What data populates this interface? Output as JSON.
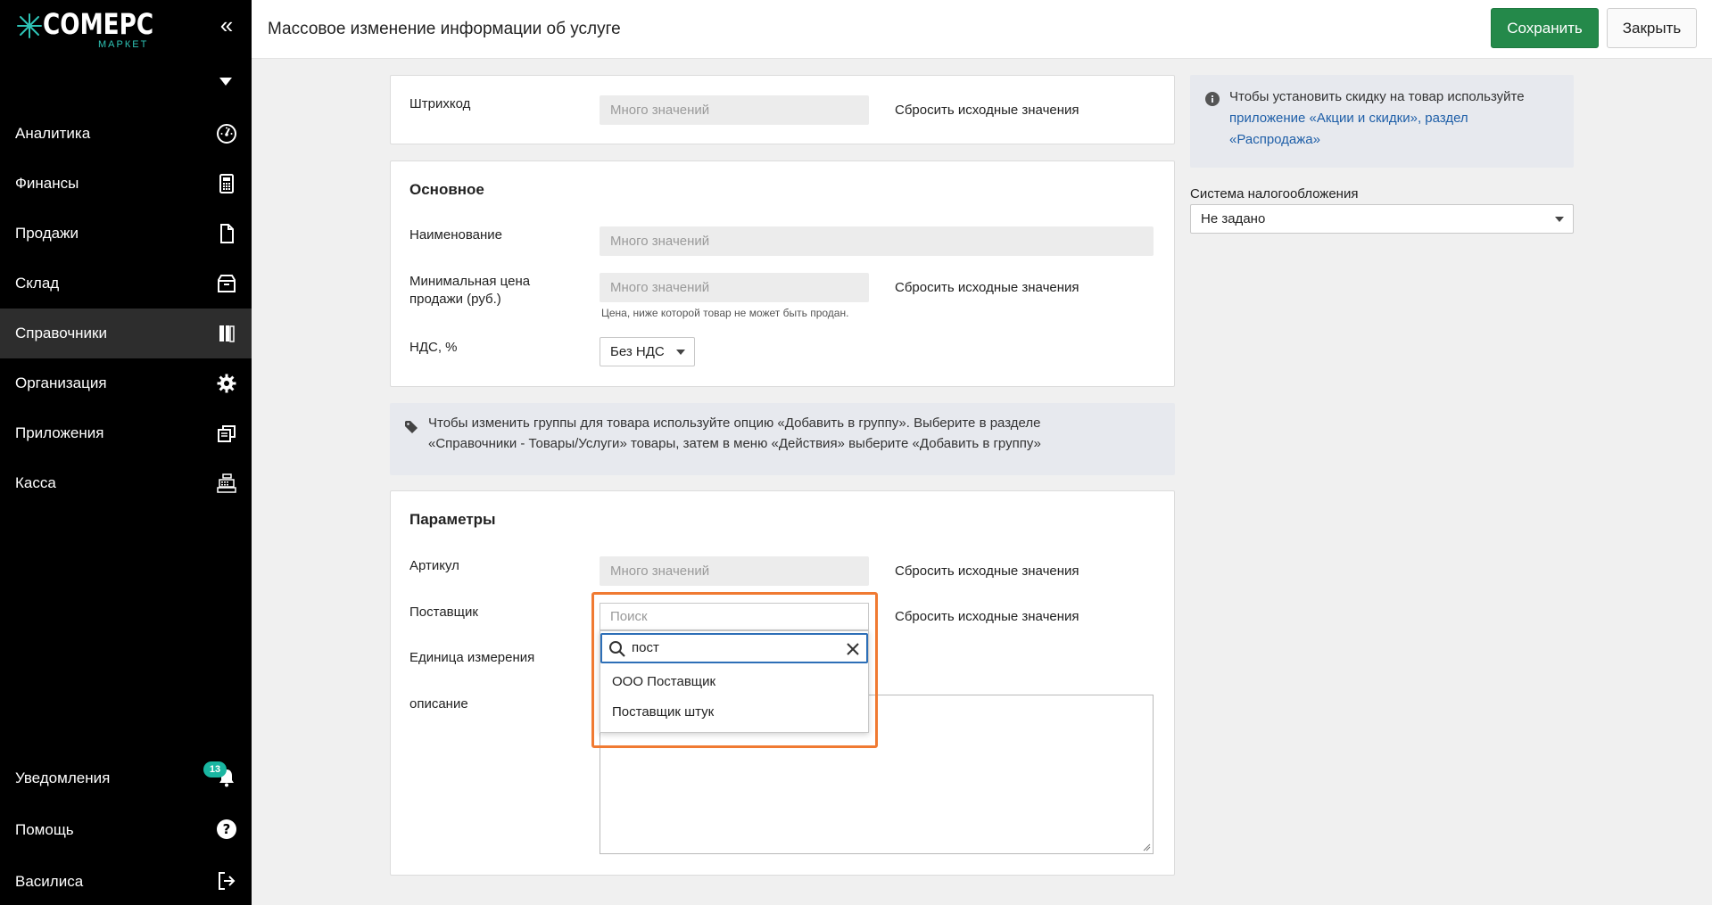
{
  "brand": {
    "name": "COMEPC",
    "sub": "МАРКЕТ",
    "accent": "#2ec4b6"
  },
  "sidebar": {
    "items": [
      {
        "label": "Аналитика",
        "icon": "dashboard-icon"
      },
      {
        "label": "Финансы",
        "icon": "calculator-icon"
      },
      {
        "label": "Продажи",
        "icon": "document-icon"
      },
      {
        "label": "Склад",
        "icon": "box-icon"
      },
      {
        "label": "Справочники",
        "icon": "books-icon",
        "active": true
      },
      {
        "label": "Организация",
        "icon": "gear-icon"
      },
      {
        "label": "Приложения",
        "icon": "windows-icon"
      },
      {
        "label": "Касса",
        "icon": "cash-register-icon"
      }
    ],
    "bottom": [
      {
        "label": "Уведомления",
        "icon": "bell-icon",
        "badge": "13"
      },
      {
        "label": "Помощь",
        "icon": "help-icon"
      },
      {
        "label": "Василиса",
        "icon": "logout-icon"
      }
    ]
  },
  "header": {
    "title": "Массовое изменение информации об услуге",
    "save_label": "Сохранить",
    "close_label": "Закрыть",
    "save_color": "#24894a"
  },
  "barcode": {
    "label": "Штрихкод",
    "placeholder": "Много значений",
    "reset": "Сбросить исходные значения"
  },
  "main": {
    "title": "Основное",
    "name_label": "Наименование",
    "name_placeholder": "Много значений",
    "min_price_label_1": "Минимальная цена",
    "min_price_label_2": "продажи (руб.)",
    "min_price_placeholder": "Много значений",
    "min_price_reset": "Сбросить исходные значения",
    "min_price_hint": "Цена, ниже которой товар не может быть продан.",
    "vat_label": "НДС, %",
    "vat_value": "Без НДС"
  },
  "groups_info": {
    "line1": "Чтобы изменить группы для товара используйте опцию «Добавить в группу». Выберите в разделе",
    "line2": "«Справочники - Товары/Услуги» товары, затем в меню «Действия» выберите «Добавить в группу»"
  },
  "params": {
    "title": "Параметры",
    "article_label": "Артикул",
    "article_placeholder": "Много значений",
    "article_reset": "Сбросить исходные значения",
    "supplier_label": "Поставщик",
    "supplier_placeholder": "Поиск",
    "supplier_reset": "Сбросить исходные значения",
    "unit_label": "Единица измерения",
    "description_label": "описание"
  },
  "supplier_dropdown": {
    "query": "пост",
    "options": [
      "ООО Поставщик",
      "Поставщик штук"
    ],
    "highlight_color": "#f07a32"
  },
  "discount_info": {
    "text": "Чтобы установить скидку на товар используйте",
    "link1": "приложение «Акции и скидки», раздел",
    "link2": "«Распродажа»"
  },
  "tax": {
    "label": "Система налогообложения",
    "value": "Не задано"
  }
}
